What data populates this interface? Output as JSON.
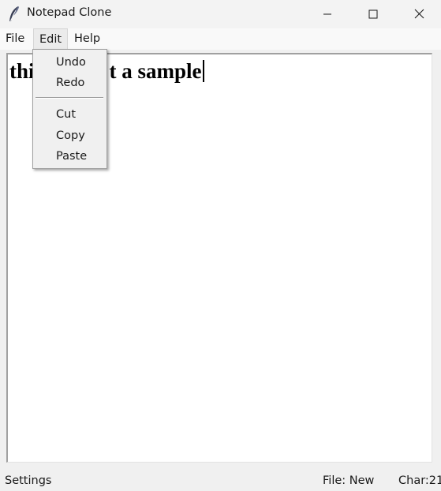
{
  "window": {
    "title": "Notepad Clone",
    "app_icon": "feather-icon",
    "controls": {
      "minimize_icon": "minimize-icon",
      "maximize_icon": "maximize-icon",
      "close_icon": "close-icon"
    }
  },
  "menubar": {
    "file": "File",
    "edit": "Edit",
    "help": "Help",
    "active": "Edit"
  },
  "editor": {
    "text_before": "thi",
    "text_after": "t a sample",
    "font_weight": "bold"
  },
  "edit_menu": {
    "items": [
      {
        "label": "Undo"
      },
      {
        "label": "Redo"
      },
      {
        "label": "Cut"
      },
      {
        "label": "Copy"
      },
      {
        "label": "Paste"
      }
    ]
  },
  "statusbar": {
    "left": "Settings",
    "file": "File: New",
    "char": "Char:21"
  },
  "colors": {
    "window_bg": "#f0f0f0",
    "editor_bg": "#ffffff",
    "text": "#000000"
  }
}
